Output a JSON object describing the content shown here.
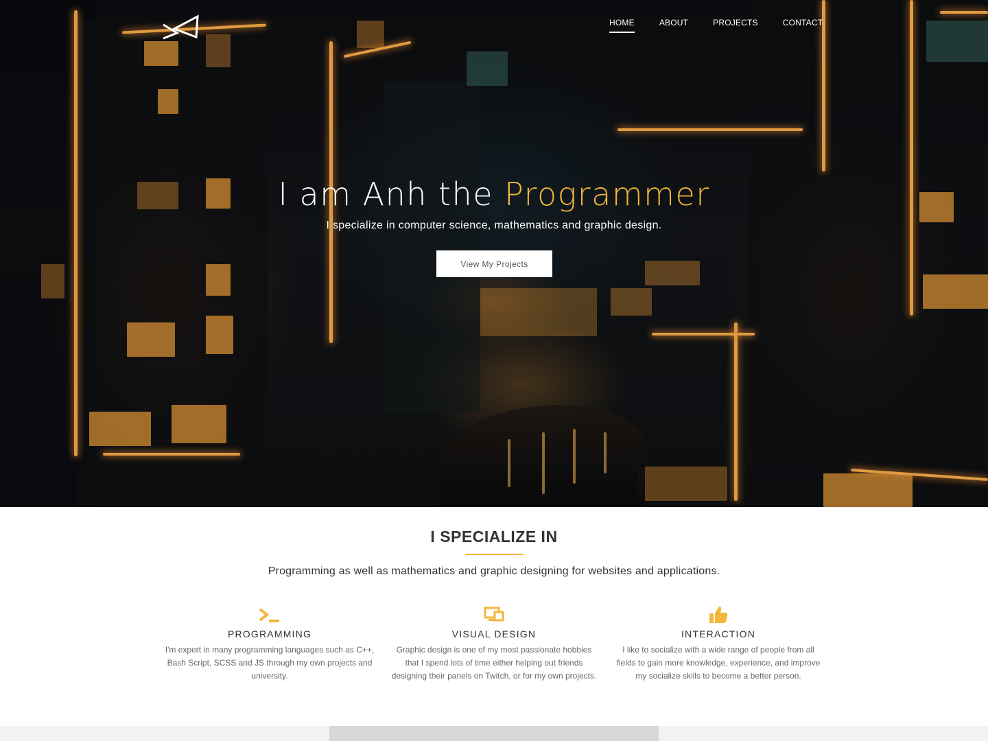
{
  "nav": {
    "items": [
      {
        "label": "HOME",
        "active": true
      },
      {
        "label": "ABOUT",
        "active": false
      },
      {
        "label": "PROJECTS",
        "active": false
      },
      {
        "label": "CONTACT",
        "active": false
      }
    ]
  },
  "hero": {
    "title_prefix": "I am Anh the ",
    "title_accent": "Programmer",
    "subtitle": "I specialize in computer science, mathematics and graphic design.",
    "button_label": "View My Projects"
  },
  "specialize": {
    "title": "I SPECIALIZE IN",
    "description": "Programming as well as mathematics and graphic designing for websites and applications.",
    "cards": [
      {
        "icon": "terminal-icon",
        "title": "PROGRAMMING",
        "text": "I'm expert in many programming languages such as C++, Bash Script, SCSS and JS through my own projects and university."
      },
      {
        "icon": "monitor-icon",
        "title": "VISUAL DESIGN",
        "text": "Graphic design is one of my most passionate hobbies that I spend lots of time either helping out friends designing their panels on Twitch, or for my own projects."
      },
      {
        "icon": "thumbs-up-icon",
        "title": "INTERACTION",
        "text": "I like to socialize with a wide range of people from all fields to gain more knowledge, experience, and improve my socialize skills to become a better person."
      }
    ]
  },
  "colors": {
    "accent": "#f5b63a",
    "hero_background": "#121417",
    "text": "#333333"
  }
}
